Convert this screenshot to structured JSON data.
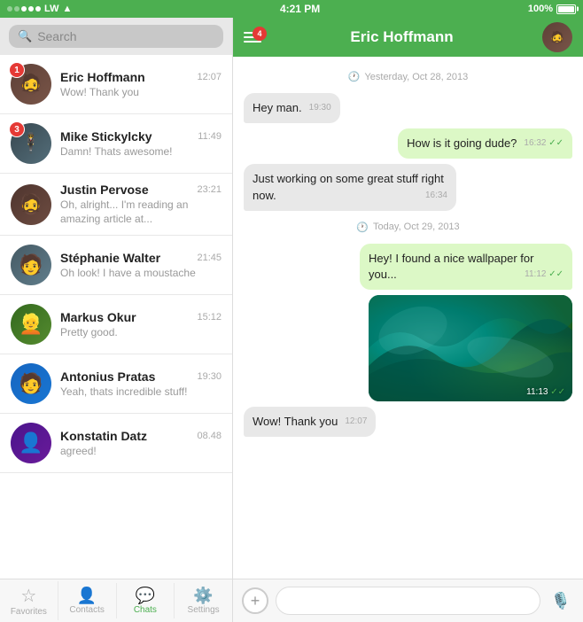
{
  "statusBar": {
    "carrier": "LW",
    "time": "4:21 PM",
    "battery": "100%",
    "signal_dots": [
      false,
      false,
      true,
      true,
      true
    ]
  },
  "search": {
    "placeholder": "Search"
  },
  "chats": [
    {
      "id": 1,
      "name": "Eric Hoffmann",
      "time": "12:07",
      "preview": "Wow! Thank you",
      "badge": 1,
      "avatarClass": "av1",
      "avatarEmoji": "🧔"
    },
    {
      "id": 2,
      "name": "Mike Stickylcky",
      "time": "11:49",
      "preview": "Damn! Thats awesome!",
      "badge": 3,
      "avatarClass": "av2",
      "avatarEmoji": "🕴️"
    },
    {
      "id": 3,
      "name": "Justin Pervose",
      "time": "23:21",
      "preview": "Oh, alright... I'm reading an amazing article at...",
      "badge": 0,
      "avatarClass": "av3",
      "avatarEmoji": "🧔"
    },
    {
      "id": 4,
      "name": "Stéphanie Walter",
      "time": "21:45",
      "preview": "Oh look! I have a moustache",
      "badge": 0,
      "avatarClass": "av4",
      "avatarEmoji": "🧑"
    },
    {
      "id": 5,
      "name": "Markus Okur",
      "time": "15:12",
      "preview": "Pretty good.",
      "badge": 0,
      "avatarClass": "av5",
      "avatarEmoji": "👱"
    },
    {
      "id": 6,
      "name": "Antonius Pratas",
      "time": "19:30",
      "preview": "Yeah, thats incredible stuff!",
      "badge": 0,
      "avatarClass": "av6",
      "avatarEmoji": "🧑"
    },
    {
      "id": 7,
      "name": "Konstatin Datz",
      "time": "08.48",
      "preview": "agreed!",
      "badge": 0,
      "avatarClass": "av7",
      "avatarEmoji": "👤"
    }
  ],
  "tabs": [
    {
      "id": "favorites",
      "label": "Favorites",
      "icon": "☆",
      "active": false
    },
    {
      "id": "contacts",
      "label": "Contacts",
      "icon": "👤",
      "active": false
    },
    {
      "id": "chats",
      "label": "Chats",
      "icon": "💬",
      "active": true
    },
    {
      "id": "settings",
      "label": "Settings",
      "icon": "⚙️",
      "active": false
    }
  ],
  "activeChat": {
    "name": "Eric Hoffmann",
    "headerBadge": 4,
    "dateDividers": [
      "Yesterday, Oct 28, 2013",
      "Today, Oct 29, 2013"
    ],
    "messages": [
      {
        "id": 1,
        "type": "incoming",
        "text": "Hey man.",
        "time": "19:30"
      },
      {
        "id": 2,
        "type": "outgoing",
        "text": "How is it going dude?",
        "time": "16:32",
        "ticks": true
      },
      {
        "id": 3,
        "type": "incoming",
        "text": "Just working on some great stuff right now.",
        "time": "16:34"
      },
      {
        "id": 4,
        "type": "outgoing",
        "text": "Hey! I found a nice wallpaper for you...",
        "time": "11:12",
        "ticks": true
      },
      {
        "id": 5,
        "type": "outgoing",
        "isImage": true,
        "time": "11:13",
        "ticks": true
      },
      {
        "id": 6,
        "type": "incoming",
        "text": "Wow! Thank you",
        "time": "12:07"
      }
    ]
  },
  "inputBar": {
    "placeholder": ""
  }
}
